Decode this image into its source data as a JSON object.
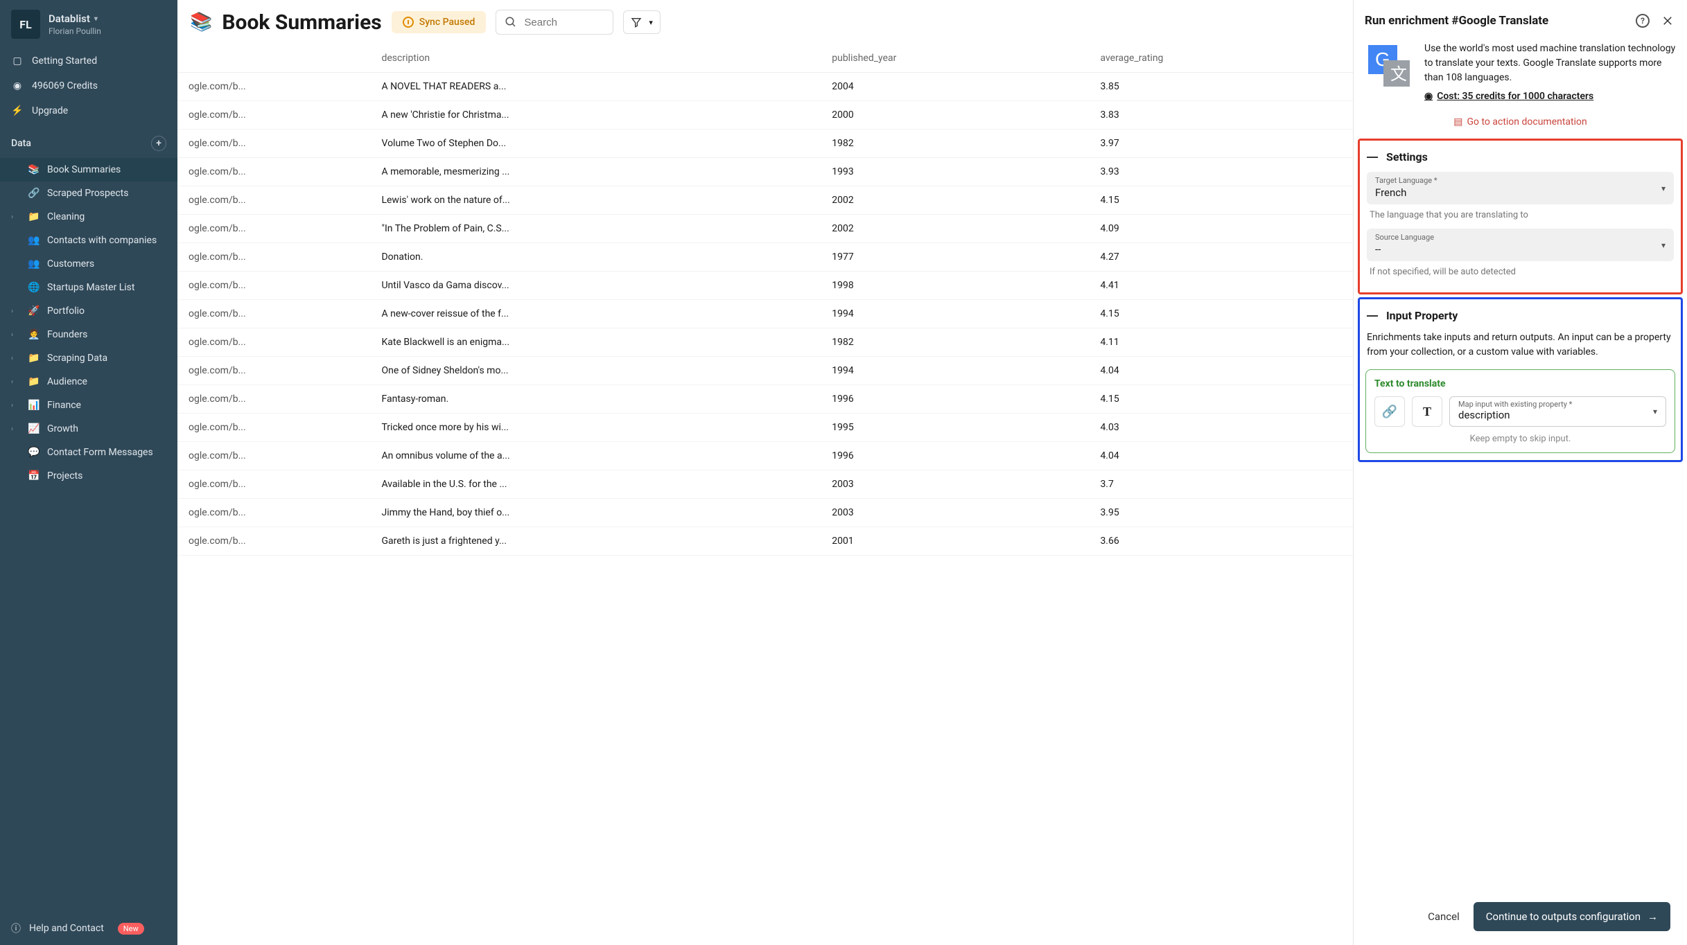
{
  "workspace": {
    "name": "Datablist",
    "user": "Florian Poullin",
    "initials": "FL"
  },
  "nav": {
    "getting_started": "Getting Started",
    "credits": "496069 Credits",
    "upgrade": "Upgrade",
    "data_header": "Data",
    "help": "Help and Contact",
    "badge_new": "New"
  },
  "lists": [
    {
      "emoji": "📚",
      "label": "Book Summaries",
      "active": true,
      "chev": false
    },
    {
      "emoji": "🔗",
      "label": "Scraped Prospects",
      "chev": false
    },
    {
      "emoji": "📁",
      "label": "Cleaning",
      "chev": true
    },
    {
      "emoji": "👥",
      "label": "Contacts with companies",
      "chev": false
    },
    {
      "emoji": "👥",
      "label": "Customers",
      "chev": false
    },
    {
      "emoji": "🌐",
      "label": "Startups Master List",
      "chev": false
    },
    {
      "emoji": "🚀",
      "label": "Portfolio",
      "chev": true
    },
    {
      "emoji": "🧑‍💼",
      "label": "Founders",
      "chev": true
    },
    {
      "emoji": "📁",
      "label": "Scraping Data",
      "chev": true
    },
    {
      "emoji": "📁",
      "label": "Audience",
      "chev": true
    },
    {
      "emoji": "📊",
      "label": "Finance",
      "chev": true
    },
    {
      "emoji": "📈",
      "label": "Growth",
      "chev": true
    },
    {
      "emoji": "💬",
      "label": "Contact Form Messages",
      "chev": false
    },
    {
      "emoji": "📅",
      "label": "Projects",
      "chev": false
    }
  ],
  "page": {
    "emoji": "📚",
    "title": "Book Summaries",
    "sync": "Sync Paused",
    "search_placeholder": "Search"
  },
  "columns": {
    "col0": "",
    "col1": "description",
    "col2": "published_year",
    "col3": "average_rating"
  },
  "rows": [
    {
      "c0": "ogle.com/b...",
      "c1": "A NOVEL THAT READERS a...",
      "c2": "2004",
      "c3": "3.85"
    },
    {
      "c0": "ogle.com/b...",
      "c1": "A new 'Christie for Christma...",
      "c2": "2000",
      "c3": "3.83"
    },
    {
      "c0": "ogle.com/b...",
      "c1": "Volume Two of Stephen Do...",
      "c2": "1982",
      "c3": "3.97"
    },
    {
      "c0": "ogle.com/b...",
      "c1": "A memorable, mesmerizing ...",
      "c2": "1993",
      "c3": "3.93"
    },
    {
      "c0": "ogle.com/b...",
      "c1": "Lewis' work on the nature of...",
      "c2": "2002",
      "c3": "4.15"
    },
    {
      "c0": "ogle.com/b...",
      "c1": "\"In The Problem of Pain, C.S...",
      "c2": "2002",
      "c3": "4.09"
    },
    {
      "c0": "ogle.com/b...",
      "c1": "Donation.",
      "c2": "1977",
      "c3": "4.27"
    },
    {
      "c0": "ogle.com/b...",
      "c1": "Until Vasco da Gama discov...",
      "c2": "1998",
      "c3": "4.41"
    },
    {
      "c0": "ogle.com/b...",
      "c1": "A new-cover reissue of the f...",
      "c2": "1994",
      "c3": "4.15"
    },
    {
      "c0": "ogle.com/b...",
      "c1": "Kate Blackwell is an enigma...",
      "c2": "1982",
      "c3": "4.11"
    },
    {
      "c0": "ogle.com/b...",
      "c1": "One of Sidney Sheldon's mo...",
      "c2": "1994",
      "c3": "4.04"
    },
    {
      "c0": "ogle.com/b...",
      "c1": "Fantasy-roman.",
      "c2": "1996",
      "c3": "4.15"
    },
    {
      "c0": "ogle.com/b...",
      "c1": "Tricked once more by his wi...",
      "c2": "1995",
      "c3": "4.03"
    },
    {
      "c0": "ogle.com/b...",
      "c1": "An omnibus volume of the a...",
      "c2": "1996",
      "c3": "4.04"
    },
    {
      "c0": "ogle.com/b...",
      "c1": "Available in the U.S. for the ...",
      "c2": "2003",
      "c3": "3.7"
    },
    {
      "c0": "ogle.com/b...",
      "c1": "Jimmy the Hand, boy thief o...",
      "c2": "2003",
      "c3": "3.95"
    },
    {
      "c0": "ogle.com/b...",
      "c1": "Gareth is just a frightened y...",
      "c2": "2001",
      "c3": "3.66"
    }
  ],
  "panel": {
    "title": "Run enrichment #Google Translate",
    "desc": "Use the world's most used machine translation technology to translate your texts. Google Translate supports more than 108 languages.",
    "cost": "Cost: 35 credits for 1000 characters",
    "doc_link": "Go to action documentation",
    "settings_header": "Settings",
    "target_lang_label": "Target Language *",
    "target_lang_value": "French",
    "target_lang_help": "The language that you are translating to",
    "source_lang_label": "Source Language",
    "source_lang_value": "--",
    "source_lang_help": "If not specified, will be auto detected",
    "input_header": "Input Property",
    "input_desc": "Enrichments take inputs and return outputs. An input can be a property from your collection, or a custom value with variables.",
    "text_to_translate": "Text to translate",
    "map_label": "Map input with existing property *",
    "map_value": "description",
    "map_help": "Keep empty to skip input.",
    "cancel": "Cancel",
    "continue": "Continue to outputs configuration"
  }
}
